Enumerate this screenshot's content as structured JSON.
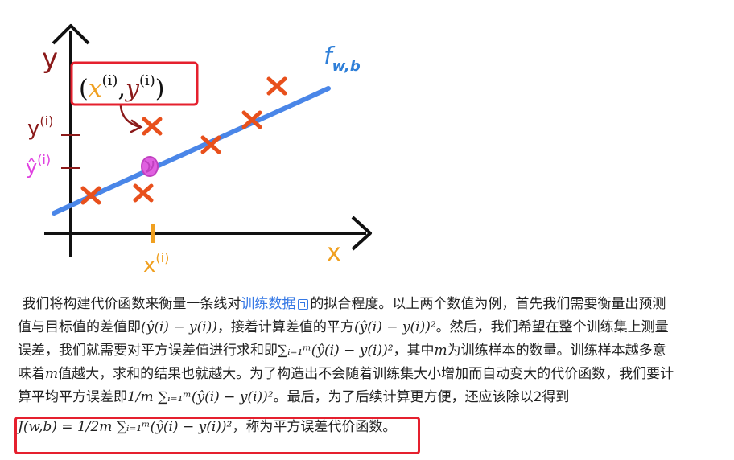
{
  "figure": {
    "y_axis_label": "y",
    "x_axis_label": "x",
    "function_label": "f",
    "function_subscript": "w,b",
    "point_label": "(x(i), y(i))",
    "y_tick_label": "y(i)",
    "yhat_tick_label": "ŷ(i)",
    "x_tick_label": "x(i)",
    "colors": {
      "axes": "#111111",
      "line": "#4a86e8",
      "marker": "#e8501c",
      "highlight": "#e5202e",
      "y_label": "#8b1a1a",
      "yhat_label": "#e040e0",
      "x_label": "#f0a020",
      "function_label": "#2f7fd8"
    }
  },
  "article": {
    "line1_a": "我们将构建代价函数来衡量一条线对",
    "link": "训练数据",
    "line1_b": "的拟合程度。以上两个数值为例，首先我们需要衡量出预测",
    "line2_a": "值与目标值的差值即",
    "line2_f1": "(ŷ(i) − y(i))",
    "line2_b": "，接着计算差值的平方",
    "line2_f2": "(ŷ(i) − y(i))²",
    "line2_c": "。然后，我们希望在整个训练集上测量",
    "line3_a": "误差，我们就需要对平方误差值进行求和即",
    "line3_f": "∑ᵢ₌₁ᵐ(ŷ(i) − y(i))²",
    "line3_b": "，其中",
    "var_m": "m",
    "line3_c": "为训练样本的数量。训练样本越多意",
    "line4_a": "味着",
    "line4_b": "值越大，求和的结果也就越大。为了构造出不会随着训练集大小增加而自动变大的代价函数，我们要计",
    "line5_a": "算平均平方误差即",
    "line5_f": "1/m ∑ᵢ₌₁ᵐ(ŷ(i) − y(i))²",
    "line5_b": "。最后，为了后续计算更方便，还应该除以2得到",
    "line6_f": "J(w,b) = 1/2m ∑ᵢ₌₁ᵐ(ŷ(i) − y(i))²",
    "line6_b": "，称为平方误差代价函数。"
  }
}
